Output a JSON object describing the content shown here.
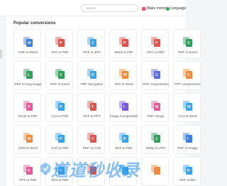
{
  "header": {
    "search_placeholder": "Search",
    "make_money_label": "Make money",
    "language_label": "Language"
  },
  "main": {
    "section_title": "Popular conversions",
    "tools": [
      {
        "label": "PDF to Word",
        "color": "#3b7de0",
        "mark": "W"
      },
      {
        "label": "JPG to PDF",
        "color": "#e0524a",
        "mark": "P"
      },
      {
        "label": "PDF to JPG",
        "color": "#3aa4e8",
        "mark": "J"
      },
      {
        "label": "Word to PDF",
        "color": "#e0524a",
        "mark": "P"
      },
      {
        "label": "OFD to PDF",
        "color": "#e0524a",
        "mark": "P"
      },
      {
        "label": "PDF to Excel",
        "color": "#2f9f5a",
        "mark": "X"
      },
      {
        "label": "PDF to long image",
        "color": "#2f9f5a",
        "mark": "L"
      },
      {
        "label": "PDF to Excel",
        "color": "#2f9f5a",
        "mark": "X"
      },
      {
        "label": "PDF decryption",
        "color": "#3aa4e8",
        "mark": "D"
      },
      {
        "label": "JPG to Word",
        "color": "#f08a3c",
        "mark": "W"
      },
      {
        "label": "PDF compression",
        "color": "#5b6ee8",
        "mark": "C"
      },
      {
        "label": "PPT compression",
        "color": "#f08a3c",
        "mark": "C"
      },
      {
        "label": "Excel to PDF",
        "color": "#e65a9a",
        "mark": "P"
      },
      {
        "label": "CAJ to PDF",
        "color": "#3aa4e8",
        "mark": "P"
      },
      {
        "label": "PDF to PPT",
        "color": "#e0524a",
        "mark": "T"
      },
      {
        "label": "Image Compression",
        "color": "#7a5ae0",
        "mark": "I"
      },
      {
        "label": "PDF merge",
        "color": "#e65a9a",
        "mark": "M"
      },
      {
        "label": "CAJ to Word",
        "color": "#3aa4e8",
        "mark": "W"
      },
      {
        "label": "OFD to Word",
        "color": "#f08a3c",
        "mark": "W"
      },
      {
        "label": "CAD to PDF",
        "color": "#3aa4e8",
        "mark": "P"
      },
      {
        "label": "PDF to CAD",
        "color": "#e0524a",
        "mark": "C"
      },
      {
        "label": "XPS to PDF",
        "color": "#3aa4e8",
        "mark": "P"
      },
      {
        "label": "Webp to JPG",
        "color": "#2f9f5a",
        "mark": "J"
      },
      {
        "label": "PDF to Image",
        "color": "#3b7de0",
        "mark": "I"
      },
      {
        "label": "PPT to PDF",
        "color": "#e65a9a",
        "mark": "P"
      },
      {
        "label": "XPS to PDF",
        "color": "#3aa4e8",
        "mark": "P"
      },
      {
        "label": "",
        "color": "#e0524a",
        "mark": ""
      },
      {
        "label": "",
        "color": "#3aa4e8",
        "mark": ""
      },
      {
        "label": "",
        "color": "#f08a3c",
        "mark": ""
      },
      {
        "label": "PDF online",
        "color": "#3aa4e8",
        "mark": "P"
      }
    ]
  },
  "watermark": {
    "text": "道道秒收录"
  }
}
